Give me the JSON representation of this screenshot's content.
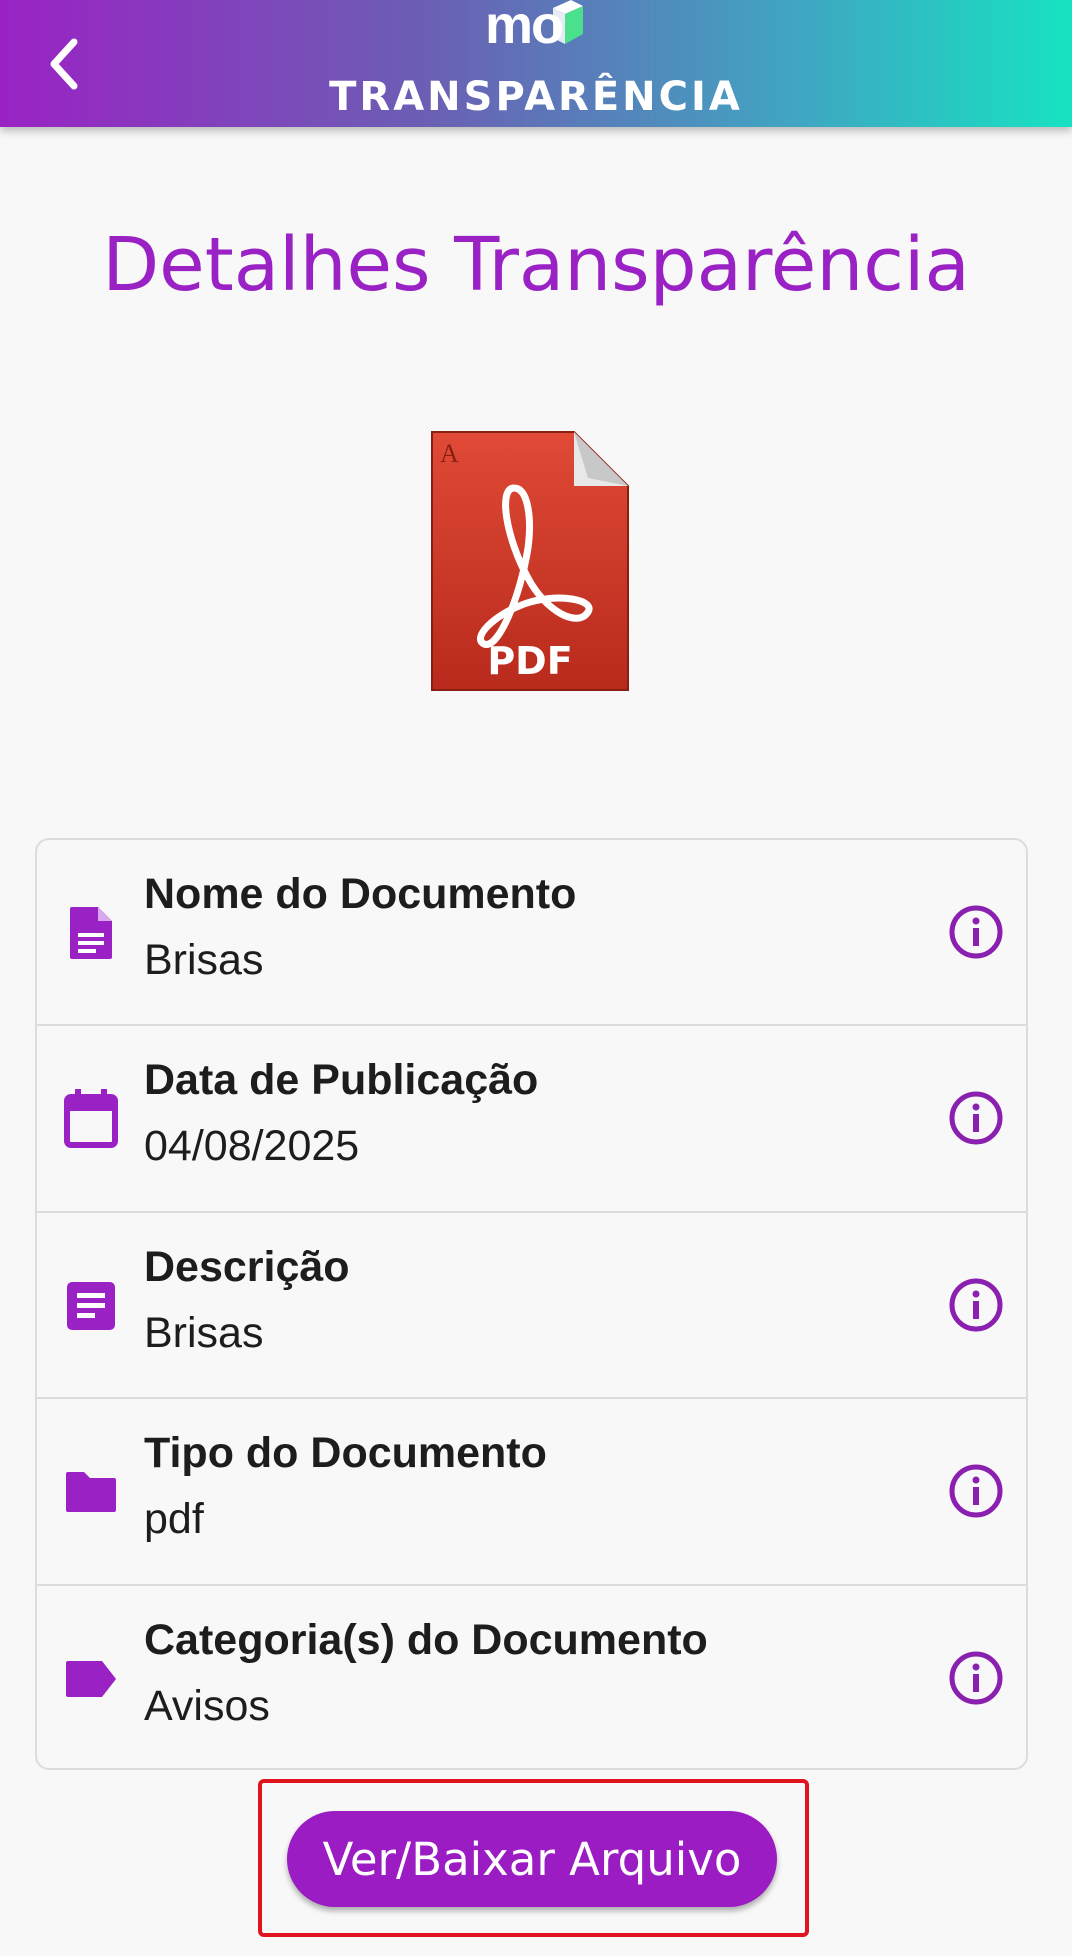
{
  "header": {
    "logo_text": "mo",
    "title": "TRANSPARÊNCIA",
    "gradient_start": "#9a22c4",
    "gradient_end": "#17e2c2"
  },
  "page": {
    "title": "Detalhes Transparência",
    "file_icon_label": "PDF"
  },
  "details": [
    {
      "icon": "document-icon",
      "label": "Nome do Documento",
      "value": "Brisas"
    },
    {
      "icon": "calendar-icon",
      "label": "Data de Publicação",
      "value": "04/08/2025"
    },
    {
      "icon": "notes-icon",
      "label": "Descrição",
      "value": "Brisas"
    },
    {
      "icon": "folder-icon",
      "label": "Tipo do Documento",
      "value": "pdf"
    },
    {
      "icon": "label-tag-icon",
      "label": "Categoria(s) do Documento",
      "value": "Avisos"
    }
  ],
  "action": {
    "label": "Ver/Baixar Arquivo"
  },
  "colors": {
    "accent": "#9a22c4",
    "button": "#9a1cc2",
    "highlight": "#e0141e"
  }
}
